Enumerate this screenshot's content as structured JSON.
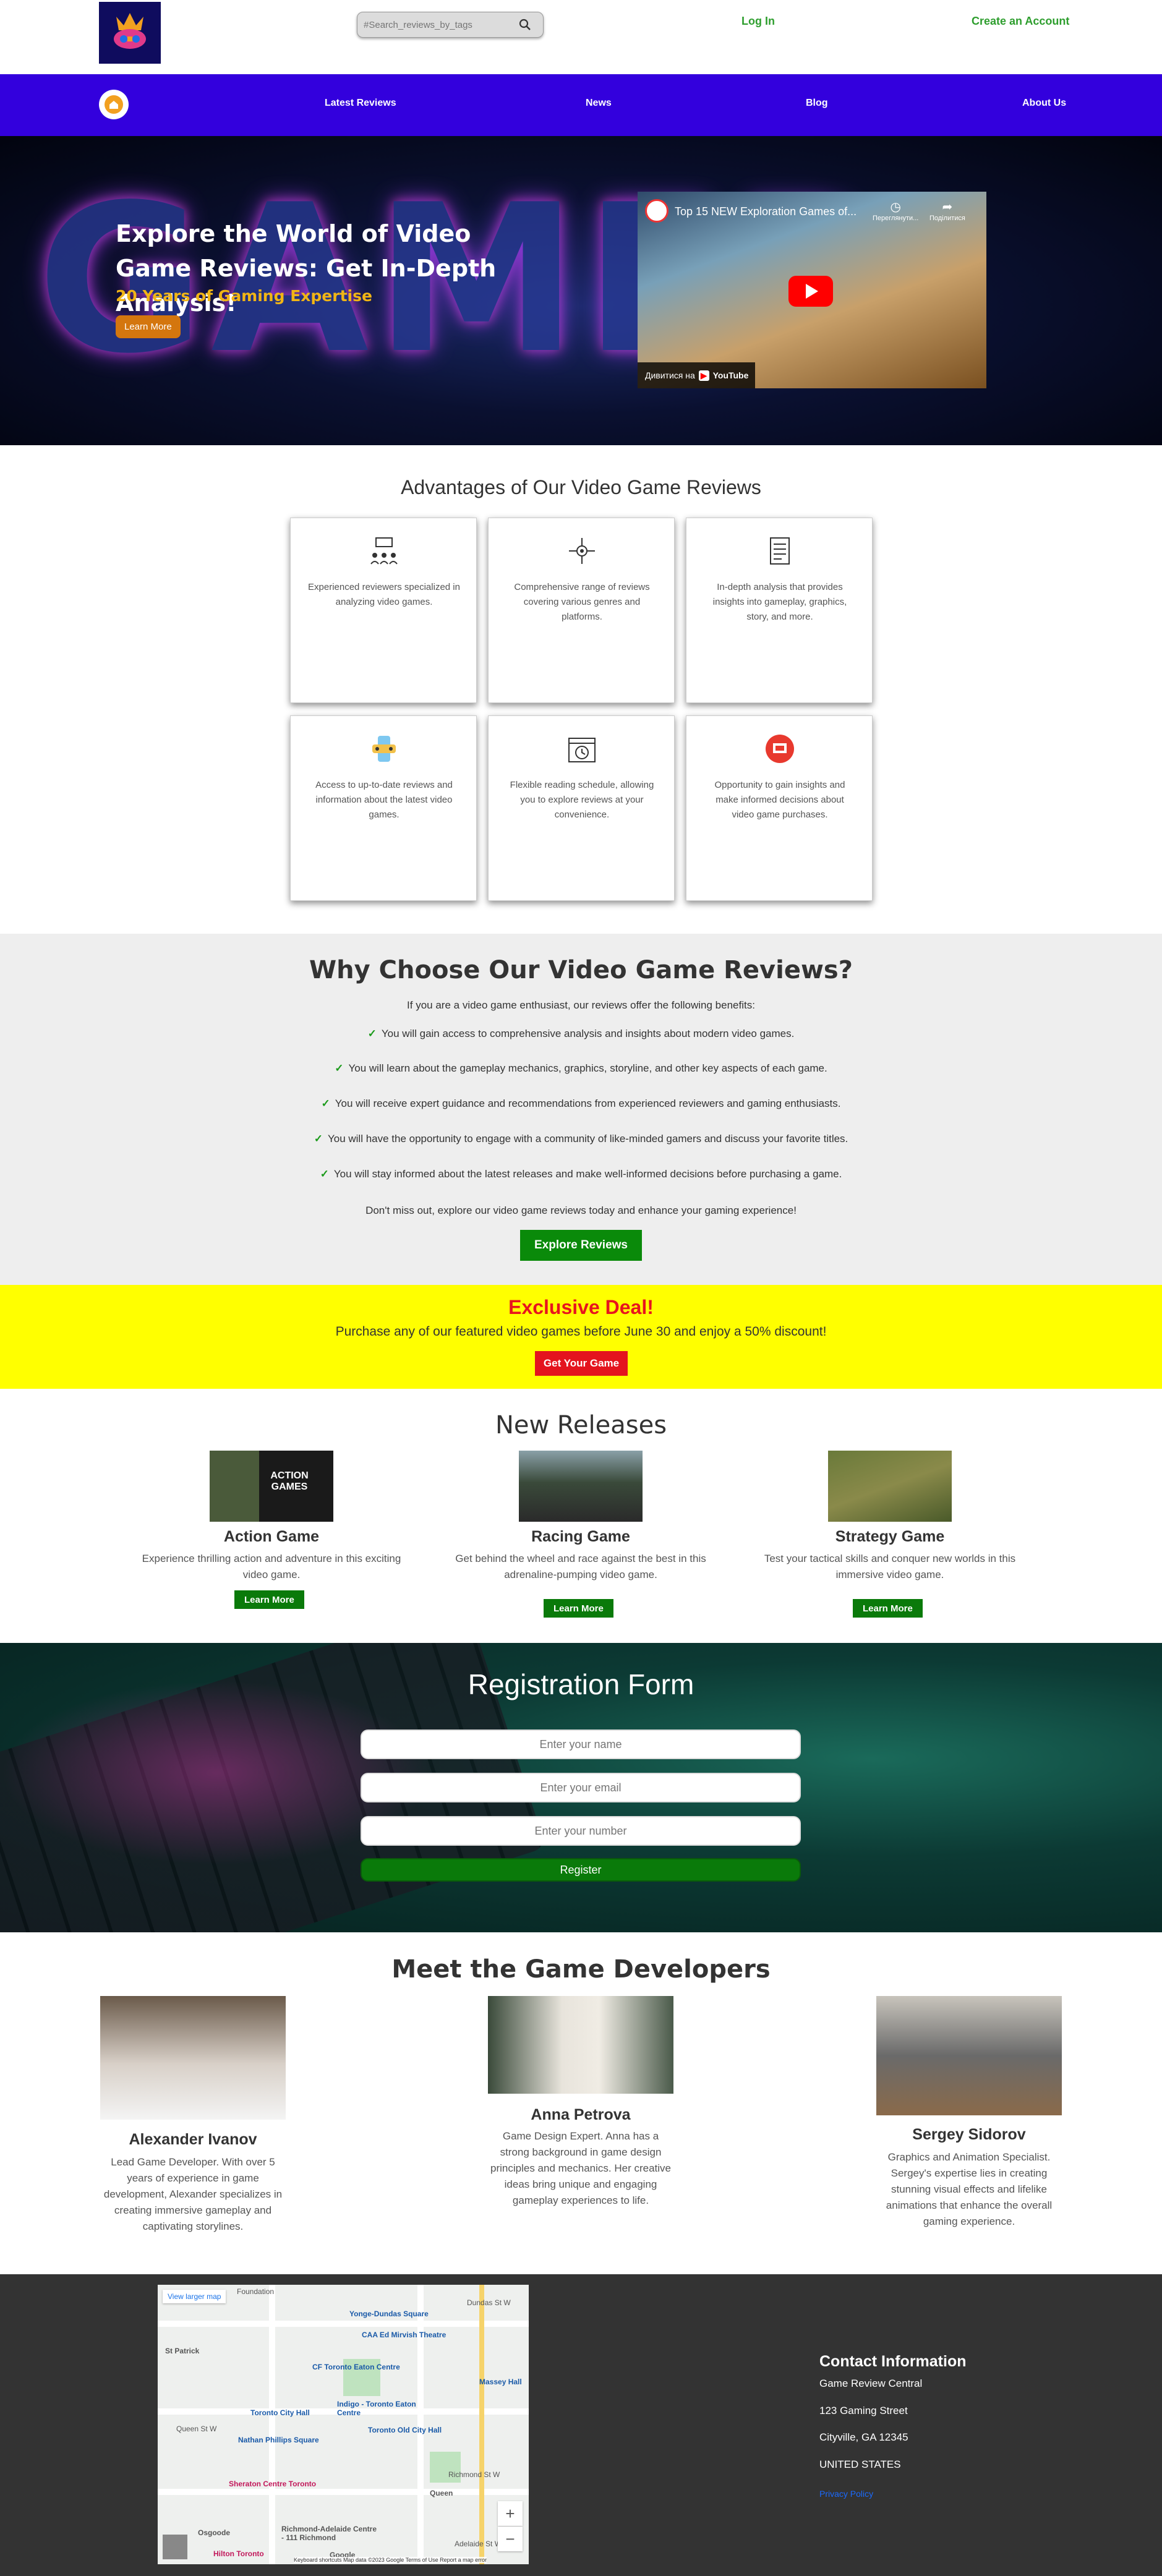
{
  "header": {
    "search_placeholder": "#Search_reviews_by_tags",
    "login": "Log In",
    "signup": "Create an Account"
  },
  "nav": {
    "items": [
      "Latest Reviews",
      "News",
      "Blog",
      "About Us"
    ]
  },
  "hero": {
    "bg_word": "GAMER",
    "title": "Explore the World of Video Game Reviews: Get In-Depth Analysis!",
    "subtitle": "20 Years of Gaming Expertise",
    "button": "Learn More",
    "video": {
      "title": "Top 15 NEW Exploration Games of...",
      "watch_later": "Переглянути...",
      "share": "Поділитися",
      "watch_on": "Дивитися на",
      "youtube": "YouTube"
    }
  },
  "advantages": {
    "title": "Advantages of Our Video Game Reviews",
    "cards": [
      {
        "icon": "reviewers-icon",
        "text": "Experienced reviewers specialized in analyzing video games."
      },
      {
        "icon": "network-icon",
        "text": "Comprehensive range of reviews covering various genres and platforms."
      },
      {
        "icon": "document-icon",
        "text": "In-depth analysis that provides insights into gameplay, graphics, story, and more."
      },
      {
        "icon": "gamepad-icon",
        "text": "Access to up-to-date reviews and information about the latest video games."
      },
      {
        "icon": "calendar-clock-icon",
        "text": "Flexible reading schedule, allowing you to explore reviews at your convenience."
      },
      {
        "icon": "insights-icon",
        "text": "Opportunity to gain insights and make informed decisions about video game purchases."
      }
    ]
  },
  "why": {
    "title": "Why Choose Our Video Game Reviews?",
    "intro": "If you are a video game enthusiast, our reviews offer the following benefits:",
    "tick": "✓",
    "benefits": [
      "You will gain access to comprehensive analysis and insights about modern video games.",
      "You will learn about the gameplay mechanics, graphics, storyline, and other key aspects of each game.",
      "You will receive expert guidance and recommendations from experienced reviewers and gaming enthusiasts.",
      "You will have the opportunity to engage with a community of like-minded gamers and discuss your favorite titles.",
      "You will stay informed about the latest releases and make well-informed decisions before purchasing a game."
    ],
    "outro": "Don't miss out, explore our video game reviews today and enhance your gaming experience!",
    "button": "Explore Reviews"
  },
  "deal": {
    "title": "Exclusive Deal!",
    "text": "Purchase any of our featured video games before June 30 and enjoy a 50% discount!",
    "button": "Get Your Game"
  },
  "releases": {
    "title": "New Releases",
    "items": [
      {
        "title": "Action Game",
        "text": "Experience thrilling action and adventure in this exciting video game.",
        "button": "Learn More",
        "thumb_text": "ACTION GAMES"
      },
      {
        "title": "Racing Game",
        "text": "Get behind the wheel and race against the best in this adrenaline-pumping video game.",
        "button": "Learn More"
      },
      {
        "title": "Strategy Game",
        "text": "Test your tactical skills and conquer new worlds in this immersive video game.",
        "button": "Learn More"
      }
    ]
  },
  "registration": {
    "title": "Registration Form",
    "name_placeholder": "Enter your name",
    "email_placeholder": "Enter your email",
    "number_placeholder": "Enter your number",
    "button": "Register"
  },
  "developers": {
    "title": "Meet the Game Developers",
    "items": [
      {
        "name": "Alexander Ivanov",
        "bio": "Lead Game Developer. With over 5 years of experience in game development, Alexander specializes in creating immersive gameplay and captivating storylines."
      },
      {
        "name": "Anna Petrova",
        "bio": "Game Design Expert. Anna has a strong background in game design principles and mechanics. Her creative ideas bring unique and engaging gameplay experiences to life."
      },
      {
        "name": "Sergey Sidorov",
        "bio": "Graphics and Animation Specialist. Sergey's expertise lies in creating stunning visual effects and lifelike animations that enhance the overall gaming experience."
      }
    ]
  },
  "footer": {
    "map": {
      "view_larger": "View larger map",
      "labels": [
        "Yonge-Dundas Square",
        "CAA Ed Mirvish Theatre",
        "CF Toronto Eaton Centre",
        "Toronto City Hall",
        "Nathan Phillips Square",
        "Indigo - Toronto Eaton Centre",
        "Toronto Old City Hall",
        "Massey Hall",
        "Sheraton Centre Toronto",
        "Richmond-Adelaide Centre - 111 Richmond",
        "Hilton Toronto",
        "Osgoode",
        "Queen",
        "Foundation",
        "St Patrick",
        "Dundas St W",
        "Queen St W",
        "Richmond St W",
        "Adelaide St W"
      ],
      "zoom_in": "+",
      "zoom_out": "−",
      "attribution": "Keyboard shortcuts  Map data ©2023 Google  Terms of Use  Report a map error",
      "google": "Google"
    },
    "contact": {
      "title": "Contact Information",
      "lines": [
        "Game Review Central",
        "123 Gaming Street",
        "Cityville, GA 12345",
        "UNITED STATES"
      ],
      "privacy": "Privacy Policy"
    }
  }
}
